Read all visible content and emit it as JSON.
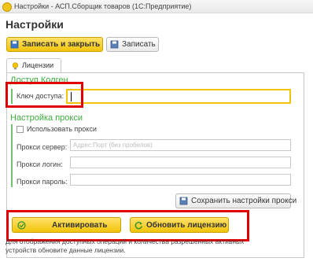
{
  "window": {
    "title": "Настройки - АСП.Сборщик товаров (1С:Предприятие)"
  },
  "page": {
    "title": "Настройки"
  },
  "toolbar": {
    "save_close_label": "Записать и закрыть",
    "save_label": "Записать"
  },
  "tabs": [
    {
      "label": "Лицензии"
    }
  ],
  "access_key": {
    "group_title": "Доступ Колген",
    "field_label": "Ключ доступа:",
    "value": ""
  },
  "proxy": {
    "group_title": "Настройка прокси",
    "use_proxy_label": "Использовать прокси",
    "use_proxy_checked": false,
    "server_label": "Прокси сервер:",
    "server_placeholder": "Адрес:Порт (без пробелов)",
    "login_label": "Прокси логин:",
    "password_label": "Прокси пароль:",
    "save_settings_label": "Сохранить настройки прокси"
  },
  "license": {
    "activate_label": "Активировать",
    "update_label": "Обновить лицензию",
    "note": "Для отображения доступных операций и количества разрешенных активных устройств обновите данные лицензии."
  },
  "colors": {
    "accent_yellow": "#f2c409",
    "group_green": "#3bab3b",
    "highlight_red": "#e10000"
  }
}
